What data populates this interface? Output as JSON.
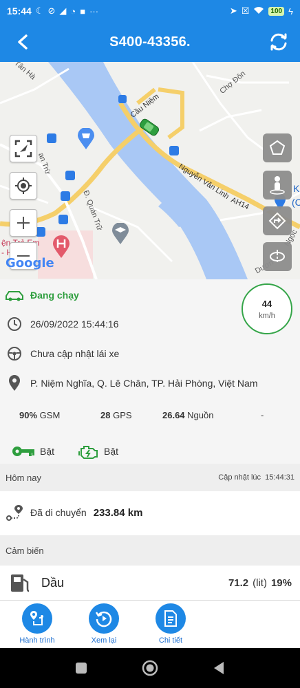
{
  "status_bar": {
    "time": "15:44",
    "battery": "100",
    "left_icons": [
      "moon-icon",
      "no-notification-icon",
      "telegram-icon",
      "pie-icon",
      "square-icon",
      "more-icon"
    ],
    "right_icons": [
      "location-arrow-icon",
      "no-sim-icon",
      "wifi-icon",
      "battery-icon",
      "charging-icon"
    ]
  },
  "header": {
    "title": "S400-43356."
  },
  "map": {
    "labels": {
      "tan_ha": "Tân Hà",
      "cho_don": "Chợ Đôn",
      "cau_niem": "Cầu Niệm",
      "nguyen_van_linh": "Nguyễn Văn Linh",
      "ah14": "AH14",
      "an_tru": "an Trừ",
      "quan_tru": "Đ. Quán Trữ",
      "duong": "Dươn",
      "ngoc": "Ngọc",
      "k": "K",
      "paren": "(C",
      "hospital_1": "ện Trẻ Em",
      "hospital_2": "- Hải"
    },
    "google": "Google"
  },
  "vehicle": {
    "status": "Đang chạy",
    "speed": "44",
    "speed_unit": "km/h",
    "timestamp": "26/09/2022 15:44:16",
    "driver": "Chưa cập nhật lái xe",
    "address": "P. Niệm Nghĩa, Q. Lê Chân, TP. Hải Phòng, Việt Nam",
    "gsm_value": "90%",
    "gsm_label": "GSM",
    "gps_value": "28",
    "gps_label": "GPS",
    "power_value": "26.64",
    "power_label": "Nguồn",
    "extra": "-",
    "key_status": "Bật",
    "engine_status": "Bật"
  },
  "today": {
    "title": "Hôm nay",
    "updated_label": "Cập nhật lúc",
    "updated_time": "15:44:31",
    "moved_label": "Đã di chuyển",
    "distance": "233.84 km"
  },
  "sensor": {
    "title": "Cảm biến",
    "name": "Dầu",
    "value": "71.2",
    "unit": "(lit)",
    "percent": "19%"
  },
  "bottom_nav": {
    "journey": "Hành trình",
    "replay": "Xem lại",
    "detail": "Chi tiết"
  },
  "colors": {
    "primary": "#1e88e5",
    "running_green": "#2e9e3e",
    "river": "#a9c8f5",
    "road_yellow": "#f5cf6a"
  }
}
